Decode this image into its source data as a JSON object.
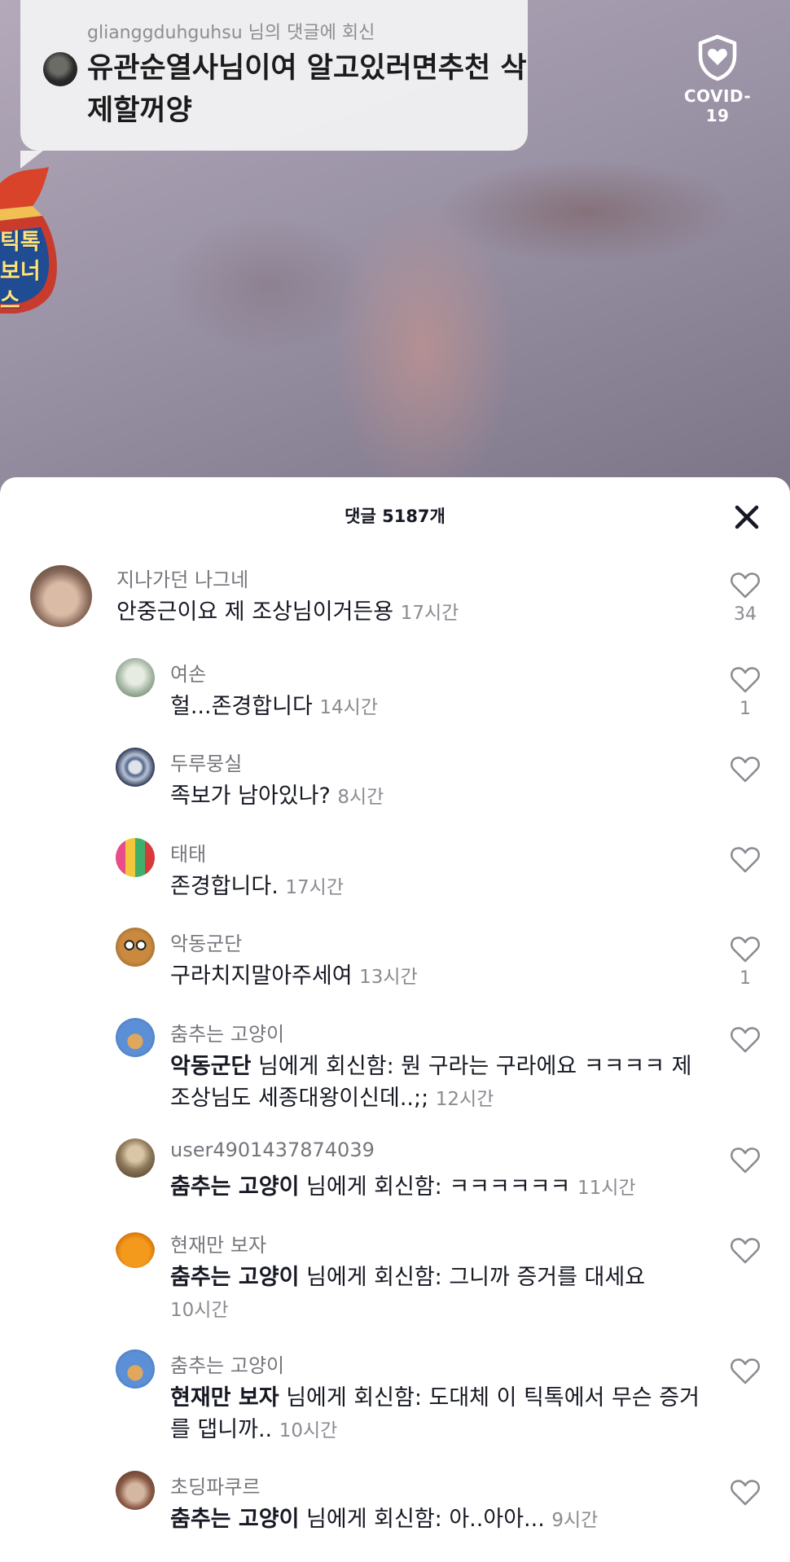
{
  "reply_banner": {
    "subtitle": "glianggduhguhsu 님의 댓글에 회신",
    "text": "유관순열사님이여 알고있러면추천 삭제할꺼양"
  },
  "badge": {
    "label": "COVID-19",
    "icon": "shield-heart-icon"
  },
  "bonus_bag_text": [
    "틱톡",
    "보너스"
  ],
  "sheet": {
    "title": "댓글 5187개",
    "close_icon": "close-icon"
  },
  "comments": [
    {
      "user": "지나가던 나그네",
      "text": "안중근이요 제 조상님이거든용",
      "time": "17시간",
      "likes": "34"
    },
    {
      "user": "여손",
      "text": "헐...존경합니다",
      "time": "14시간",
      "likes": "1"
    },
    {
      "user": "두루뭉실",
      "text": "족보가 남아있나?",
      "time": "8시간",
      "likes": ""
    },
    {
      "user": "태태",
      "text": "존경합니다.",
      "time": "17시간",
      "likes": ""
    },
    {
      "user": "악동군단",
      "text": "구라치지말아주세여",
      "time": "13시간",
      "likes": "1"
    },
    {
      "user": "춤추는 고양이",
      "mention": "악동군단",
      "reply_word": " 님에게 회신함: ",
      "text": "뭔 구라는 구라에요 ㅋㅋㅋㅋ 제 조상님도 세종대왕이신데..;;",
      "time": "12시간",
      "likes": ""
    },
    {
      "user": "user4901437874039",
      "mention": "춤추는 고양이",
      "reply_word": " 님에게 회신함: ",
      "text": "ㅋㅋㅋㅋㅋㅋ",
      "time": "11시간",
      "likes": ""
    },
    {
      "user": "현재만 보자",
      "mention": "춤추는 고양이",
      "reply_word": " 님에게 회신함: ",
      "text": "그니까 증거를 대세요",
      "time": "10시간",
      "likes": ""
    },
    {
      "user": "춤추는 고양이",
      "mention": "현재만 보자",
      "reply_word": " 님에게 회신함: ",
      "text": "도대체 이 틱톡에서 무슨 증거를 댑니까..",
      "time": "10시간",
      "likes": ""
    },
    {
      "user": "초딩파쿠르",
      "mention": "춤추는 고양이",
      "reply_word": " 님에게 회신함: ",
      "text": "아..아아...",
      "time": "9시간",
      "likes": ""
    }
  ]
}
